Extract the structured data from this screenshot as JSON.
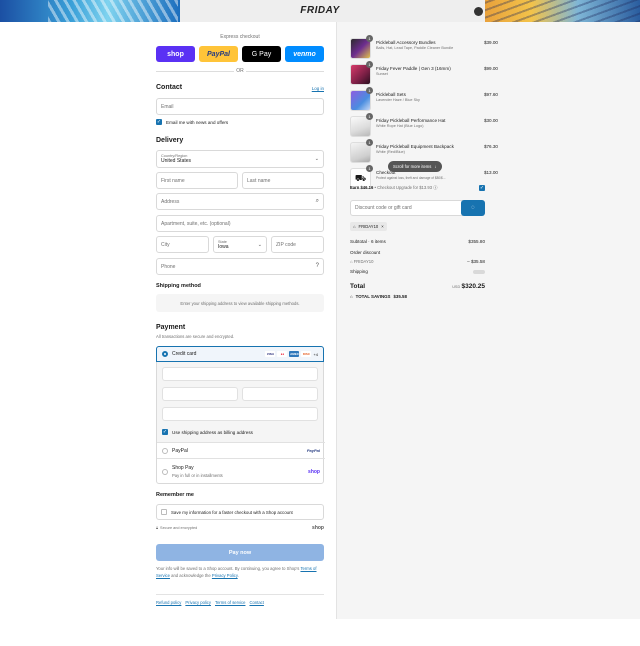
{
  "header": {
    "brand": "FRIDAY"
  },
  "express": {
    "label": "Express checkout",
    "buttons": [
      "shop",
      "PayPal",
      "G Pay",
      "venmo"
    ],
    "or": "OR"
  },
  "contact": {
    "title": "Contact",
    "login": "Log in",
    "email_placeholder": "Email",
    "news_label": "Email me with news and offers"
  },
  "delivery": {
    "title": "Delivery",
    "country_label": "Country/Region",
    "country_value": "United States",
    "first_name": "First name",
    "last_name": "Last name",
    "address": "Address",
    "apartment": "Apartment, suite, etc. (optional)",
    "city": "City",
    "state_label": "State",
    "state_value": "Iowa",
    "zip": "ZIP code",
    "phone": "Phone"
  },
  "shipping": {
    "title": "Shipping method",
    "note": "Enter your shipping address to view available shipping methods."
  },
  "payment": {
    "title": "Payment",
    "subtitle": "All transactions are secure and encrypted.",
    "credit_card": "Credit card",
    "cards": [
      "VISA",
      "MC",
      "AMEX",
      "DISC"
    ],
    "more_cards": "+4",
    "billing_label": "Use shipping address as billing address",
    "paypal": "PayPal",
    "paypal_logo": "PayPal",
    "shoppay": "Shop Pay",
    "shoppay_sub": "Pay in full or in installments",
    "shop_logo": "shop"
  },
  "remember": {
    "title": "Remember me",
    "save_label": "Save my information for a faster checkout with a Shop account",
    "secure": "Secure and encrypted",
    "shop_logo": "shop"
  },
  "paynow": {
    "label": "Pay now",
    "legal_1": "Your info will be saved to a Shop account. By continuing, you agree to Shop's",
    "legal_tos": "Terms of Service",
    "legal_mid": "and acknowledge the",
    "legal_pp": "Privacy Policy",
    "legal_end": "."
  },
  "footer": {
    "links": [
      "Refund policy",
      "Privacy policy",
      "Terms of service",
      "Contact"
    ]
  },
  "summary": {
    "items": [
      {
        "qty": "1",
        "name": "Pickleball Accessory Bundles",
        "variant": "Balls, Hat, Lead Tape, Paddle Cleaner Bundle",
        "price": "$39.00"
      },
      {
        "qty": "1",
        "name": "Friday Fever Paddle | Gen 3 (16mm)",
        "variant": "Sunset",
        "price": "$99.00"
      },
      {
        "qty": "1",
        "name": "Pickleball Sets",
        "variant": "Lavender Haze / Blue Sky",
        "price": "$97.60"
      },
      {
        "qty": "1",
        "name": "Friday Pickleball Performance Hat",
        "variant": "White Rope Hat (Blue Logo)",
        "price": "$30.00"
      },
      {
        "qty": "1",
        "name": "Friday Pickleball Equipment Backpack",
        "variant": "White (Red/Blue)",
        "price": "$76.30"
      },
      {
        "qty": "1",
        "name": "Checkout",
        "variant": "Protect against loss, theft and damage of $80/$...",
        "price": "$13.00"
      }
    ],
    "scroll_tooltip": "Scroll for more items",
    "earn_bold": "Earn $46.16",
    "earn_text": "• Checkout Upgrade for $13.93",
    "discount_placeholder": "Discount code or gift card",
    "code": "FRIDAY10",
    "subtotal_label": "Subtotal · 6 items",
    "subtotal_value": "$355.80",
    "order_discount": "Order discount",
    "discount_code": "FRIDAY10",
    "discount_value": "– $35.58",
    "shipping_label": "Shipping",
    "total_label": "Total",
    "currency": "USD",
    "total_value": "$320.25",
    "savings_label": "TOTAL SAVINGS",
    "savings_value": "$35.58"
  },
  "colors": {
    "accent": "#1773b0",
    "shop": "#5a31f4",
    "paypal": "#ffc439",
    "venmo": "#008cff",
    "paynow": "#8fb4e3"
  }
}
